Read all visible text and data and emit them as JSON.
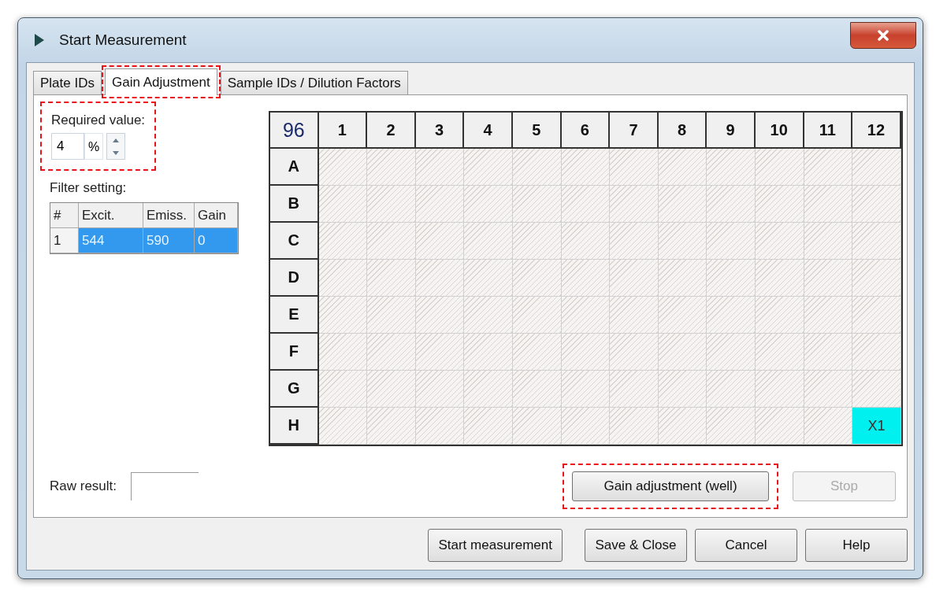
{
  "window": {
    "title": "Start Measurement"
  },
  "tabs": [
    {
      "label": "Plate IDs",
      "selected": false,
      "highlighted": false
    },
    {
      "label": "Gain Adjustment",
      "selected": true,
      "highlighted": true
    },
    {
      "label": "Sample IDs / Dilution Factors",
      "selected": false,
      "highlighted": false
    }
  ],
  "required_value": {
    "label": "Required value:",
    "value": "4",
    "unit": "%",
    "highlighted": true
  },
  "filter_setting": {
    "label": "Filter setting:",
    "columns": [
      "#",
      "Excit.",
      "Emiss.",
      "Gain"
    ],
    "rows": [
      {
        "cells": [
          "1",
          "544",
          "590",
          "0"
        ],
        "selected": true
      }
    ]
  },
  "plate": {
    "corner": "96",
    "columns": [
      "1",
      "2",
      "3",
      "4",
      "5",
      "6",
      "7",
      "8",
      "9",
      "10",
      "11",
      "12"
    ],
    "rows": [
      {
        "label": "A",
        "wells": [
          {
            "assigned": false
          },
          {
            "assigned": false
          },
          {
            "assigned": false
          },
          {
            "assigned": false
          },
          {
            "assigned": false
          },
          {
            "assigned": false
          },
          {
            "assigned": false
          },
          {
            "assigned": false
          },
          {
            "assigned": false
          },
          {
            "assigned": false
          },
          {
            "assigned": false
          },
          {
            "assigned": false
          }
        ]
      },
      {
        "label": "B",
        "wells": [
          {
            "assigned": false
          },
          {
            "assigned": false
          },
          {
            "assigned": false
          },
          {
            "assigned": false
          },
          {
            "assigned": false
          },
          {
            "assigned": false
          },
          {
            "assigned": false
          },
          {
            "assigned": false
          },
          {
            "assigned": false
          },
          {
            "assigned": false
          },
          {
            "assigned": false
          },
          {
            "assigned": false
          }
        ]
      },
      {
        "label": "C",
        "wells": [
          {
            "assigned": false
          },
          {
            "assigned": false
          },
          {
            "assigned": false
          },
          {
            "assigned": false
          },
          {
            "assigned": false
          },
          {
            "assigned": false
          },
          {
            "assigned": false
          },
          {
            "assigned": false
          },
          {
            "assigned": false
          },
          {
            "assigned": false
          },
          {
            "assigned": false
          },
          {
            "assigned": false
          }
        ]
      },
      {
        "label": "D",
        "wells": [
          {
            "assigned": false
          },
          {
            "assigned": false
          },
          {
            "assigned": false
          },
          {
            "assigned": false
          },
          {
            "assigned": false
          },
          {
            "assigned": false
          },
          {
            "assigned": false
          },
          {
            "assigned": false
          },
          {
            "assigned": false
          },
          {
            "assigned": false
          },
          {
            "assigned": false
          },
          {
            "assigned": false
          }
        ]
      },
      {
        "label": "E",
        "wells": [
          {
            "assigned": false
          },
          {
            "assigned": false
          },
          {
            "assigned": false
          },
          {
            "assigned": false
          },
          {
            "assigned": false
          },
          {
            "assigned": false
          },
          {
            "assigned": false
          },
          {
            "assigned": false
          },
          {
            "assigned": false
          },
          {
            "assigned": false
          },
          {
            "assigned": false
          },
          {
            "assigned": false
          }
        ]
      },
      {
        "label": "F",
        "wells": [
          {
            "assigned": false
          },
          {
            "assigned": false
          },
          {
            "assigned": false
          },
          {
            "assigned": false
          },
          {
            "assigned": false
          },
          {
            "assigned": false
          },
          {
            "assigned": false
          },
          {
            "assigned": false
          },
          {
            "assigned": false
          },
          {
            "assigned": false
          },
          {
            "assigned": false
          },
          {
            "assigned": false
          }
        ]
      },
      {
        "label": "G",
        "wells": [
          {
            "assigned": false
          },
          {
            "assigned": false
          },
          {
            "assigned": false
          },
          {
            "assigned": false
          },
          {
            "assigned": false
          },
          {
            "assigned": false
          },
          {
            "assigned": false
          },
          {
            "assigned": false
          },
          {
            "assigned": false
          },
          {
            "assigned": false
          },
          {
            "assigned": false
          },
          {
            "assigned": false
          }
        ]
      },
      {
        "label": "H",
        "wells": [
          {
            "assigned": false
          },
          {
            "assigned": false
          },
          {
            "assigned": false
          },
          {
            "assigned": false
          },
          {
            "assigned": false
          },
          {
            "assigned": false
          },
          {
            "assigned": false
          },
          {
            "assigned": false
          },
          {
            "assigned": false
          },
          {
            "assigned": false
          },
          {
            "assigned": false
          },
          {
            "assigned": true,
            "label": "X1"
          }
        ]
      }
    ]
  },
  "raw_result": {
    "label": "Raw result:"
  },
  "panel_buttons": [
    {
      "label": "Gain adjustment (well)",
      "disabled": false,
      "highlighted": true
    },
    {
      "label": "Stop",
      "disabled": true,
      "highlighted": false
    }
  ],
  "buttons": [
    {
      "label": "Start measurement"
    },
    {
      "label": "Save & Close"
    },
    {
      "label": "Cancel"
    },
    {
      "label": "Help"
    }
  ]
}
